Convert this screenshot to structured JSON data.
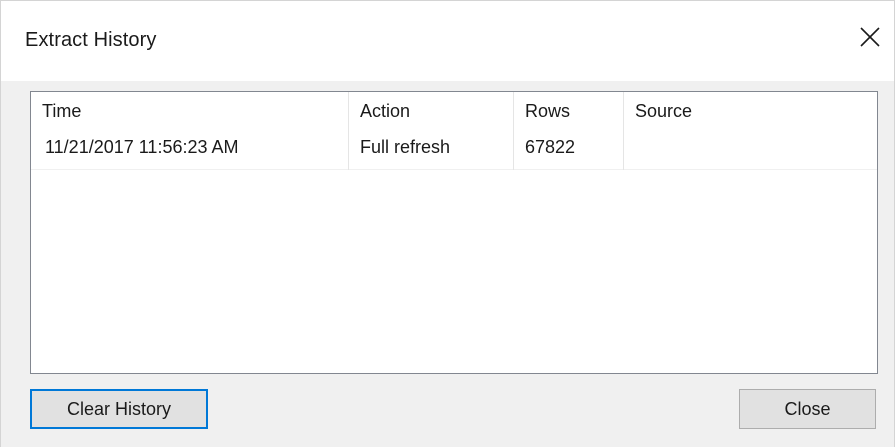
{
  "window": {
    "title": "Extract History",
    "close_icon": "close-icon"
  },
  "table": {
    "columns": [
      "Time",
      "Action",
      "Rows",
      "Source"
    ],
    "rows": [
      {
        "time": "11/21/2017 11:56:23 AM",
        "action": "Full refresh",
        "rows": "67822",
        "source": ""
      }
    ]
  },
  "buttons": {
    "clear_history": "Clear History",
    "close": "Close"
  },
  "colors": {
    "dialog_bg": "#f0f0f0",
    "title_bg": "#ffffff",
    "focus_border": "#0078d7",
    "button_bg": "#e1e1e1"
  }
}
